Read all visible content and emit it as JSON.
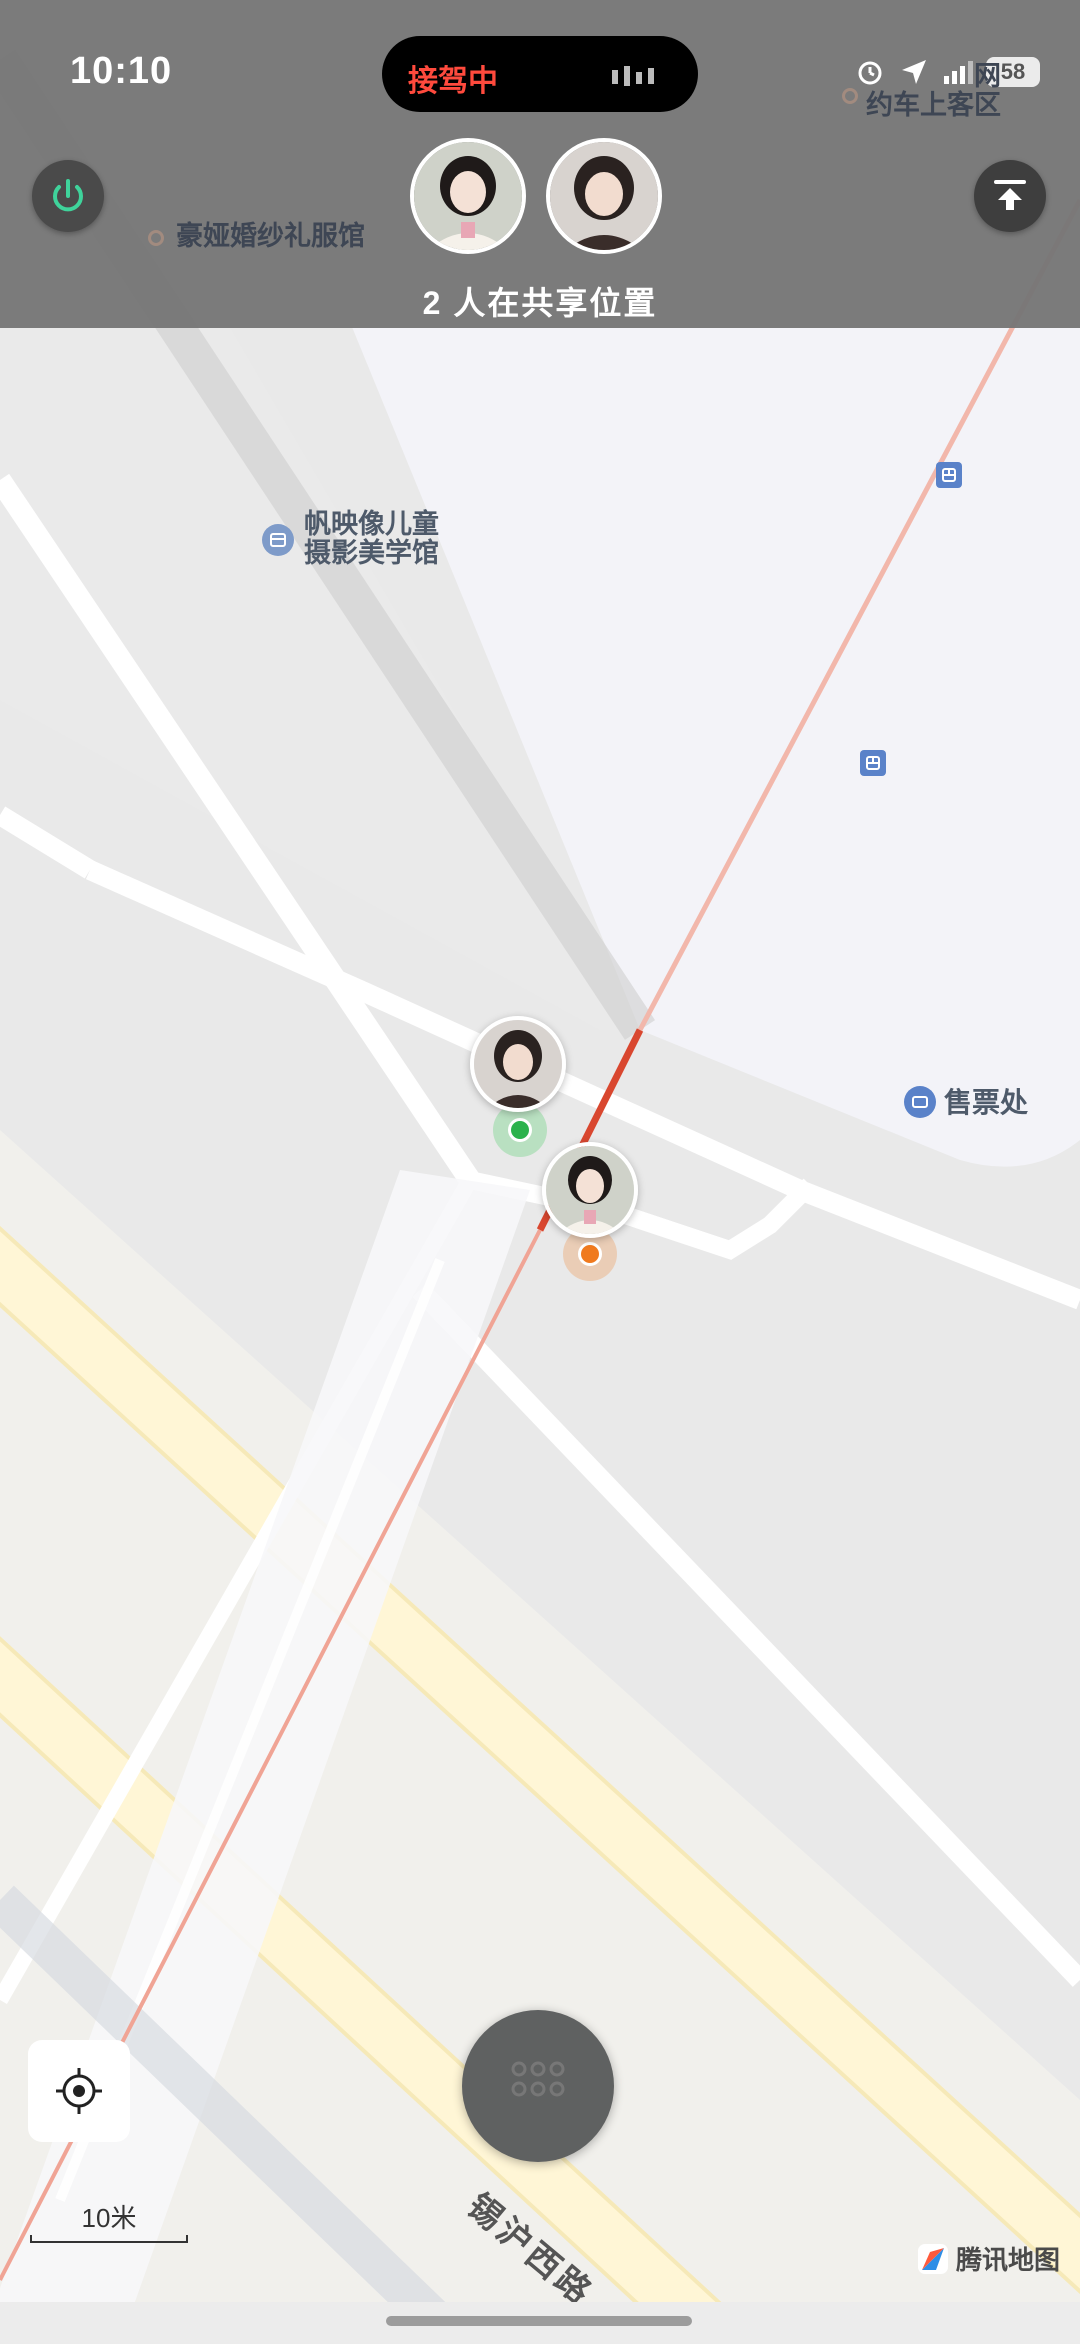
{
  "status_bar": {
    "time": "10:10",
    "battery": "58"
  },
  "dynamic_island": {
    "label": "接驾中"
  },
  "header": {
    "share_count_label": "2 人在共享位置"
  },
  "map": {
    "poi": {
      "wedding_shop": "豪娅婚纱礼服馆",
      "photo_studio_line1": "帆映像儿童",
      "photo_studio_line2": "摄影美学馆",
      "pickup_area_line1": "网",
      "pickup_area_line2": "约车上客区",
      "ticket_office": "售票处"
    },
    "road_name": "锡沪西路",
    "scale_label": "10米",
    "provider": "腾讯地图"
  },
  "icons": {
    "power": "power-icon",
    "upload": "upload-to-top-icon",
    "locate": "locate-crosshair-icon",
    "menu": "grid-dots-icon"
  },
  "colors": {
    "header_bg": "#767676",
    "island_label": "#ff4a3d",
    "power_green": "#3fd39b",
    "route_red": "#d9472f",
    "pin_green": "#2bb24c",
    "pin_orange": "#f07a1e"
  }
}
